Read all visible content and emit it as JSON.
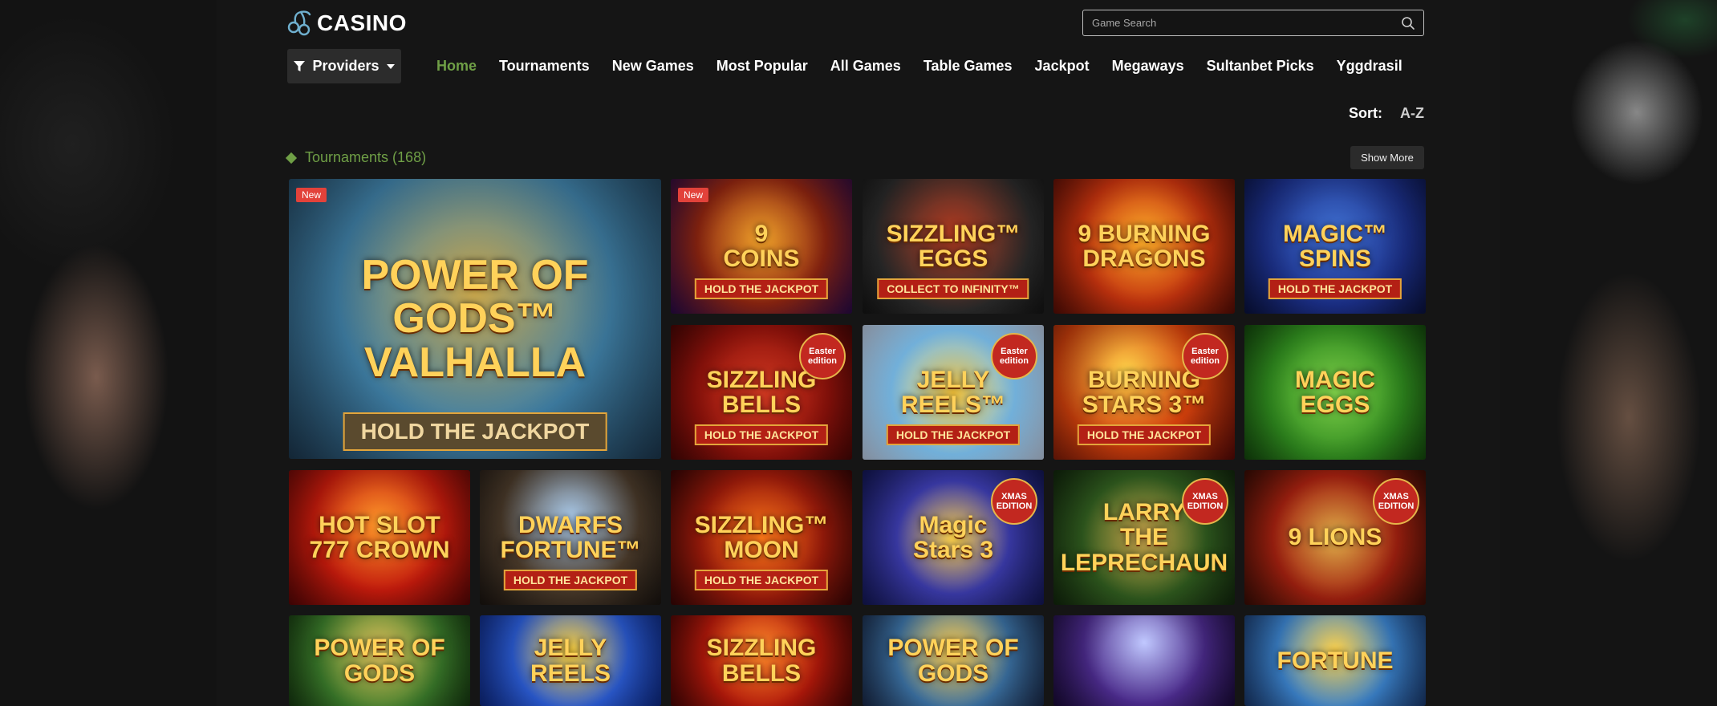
{
  "app": {
    "logo_text": "CASINO",
    "logo_icon": "cherry-icon"
  },
  "search": {
    "placeholder": "Game Search",
    "value": "",
    "icon": "search-icon"
  },
  "providers": {
    "label": "Providers",
    "icons": [
      "filter-icon",
      "caret-down-icon"
    ]
  },
  "nav": {
    "items": [
      {
        "label": "Home",
        "active": true
      },
      {
        "label": "Tournaments",
        "active": false
      },
      {
        "label": "New Games",
        "active": false
      },
      {
        "label": "Most Popular",
        "active": false
      },
      {
        "label": "All Games",
        "active": false
      },
      {
        "label": "Table Games",
        "active": false
      },
      {
        "label": "Jackpot",
        "active": false
      },
      {
        "label": "Megaways",
        "active": false
      },
      {
        "label": "Sultanbet Picks",
        "active": false
      },
      {
        "label": "Yggdrasil",
        "active": false
      }
    ]
  },
  "sort": {
    "label": "Sort:",
    "value": "A-Z"
  },
  "section": {
    "title": "Tournaments (168)",
    "show_more": "Show More"
  },
  "colors": {
    "accent_green": "#6f9f46",
    "page_bg": "#151515",
    "badge_red": "#e2423a"
  },
  "games": [
    {
      "title": "POWER OF GODS™\nVALHALLA",
      "subtitle": "HOLD THE JACKPOT",
      "badge": "New",
      "edition": ""
    },
    {
      "title": "9\nCOINS",
      "subtitle": "HOLD THE JACKPOT",
      "badge": "New",
      "edition": ""
    },
    {
      "title": "SIZZLING™\nEGGS",
      "subtitle": "COLLECT TO INFINITY™",
      "badge": "",
      "edition": ""
    },
    {
      "title": "9 BURNING\nDRAGONS",
      "subtitle": "",
      "badge": "",
      "edition": ""
    },
    {
      "title": "MAGIC™\nSPINS",
      "subtitle": "HOLD THE JACKPOT",
      "badge": "",
      "edition": ""
    },
    {
      "title": "SIZZLING\nBELLS",
      "subtitle": "HOLD THE JACKPOT",
      "badge": "",
      "edition": "Easter\nedition"
    },
    {
      "title": "JELLY\nREELS™",
      "subtitle": "HOLD THE JACKPOT",
      "badge": "",
      "edition": "Easter\nedition"
    },
    {
      "title": "BURNING STARS 3™",
      "subtitle": "HOLD THE JACKPOT",
      "badge": "",
      "edition": "Easter\nedition"
    },
    {
      "title": "MAGIC\nEGGS",
      "subtitle": "",
      "badge": "",
      "edition": ""
    },
    {
      "title": "HOT SLOT\n777 CROWN",
      "subtitle": "",
      "badge": "",
      "edition": ""
    },
    {
      "title": "DWARFS\nFORTUNE™",
      "subtitle": "HOLD THE JACKPOT",
      "badge": "",
      "edition": ""
    },
    {
      "title": "SIZZLING™\nMOON",
      "subtitle": "HOLD THE JACKPOT",
      "badge": "",
      "edition": ""
    },
    {
      "title": "Magic\nStars 3",
      "subtitle": "",
      "badge": "",
      "edition": "XMAS\nEDITION"
    },
    {
      "title": "LARRY\nTHE\nLEPRECHAUN",
      "subtitle": "",
      "badge": "",
      "edition": "XMAS\nEDITION"
    },
    {
      "title": "9 LIONS",
      "subtitle": "",
      "badge": "",
      "edition": "XMAS\nEDITION"
    },
    {
      "title": "POWER OF GODS",
      "subtitle": "",
      "badge": "",
      "edition": ""
    },
    {
      "title": "JELLY\nREELS",
      "subtitle": "",
      "badge": "",
      "edition": ""
    },
    {
      "title": "SIZZLING\nBELLS",
      "subtitle": "",
      "badge": "",
      "edition": ""
    },
    {
      "title": "POWER OF GODS",
      "subtitle": "",
      "badge": "",
      "edition": ""
    },
    {
      "title": "",
      "subtitle": "",
      "badge": "",
      "edition": ""
    },
    {
      "title": "FORTUNE",
      "subtitle": "",
      "badge": "",
      "edition": ""
    }
  ]
}
